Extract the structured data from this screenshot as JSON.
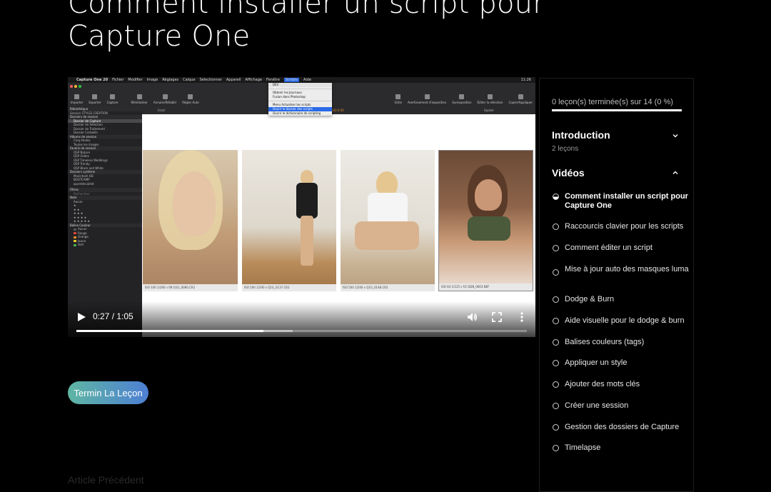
{
  "page": {
    "title": "Comment installer un script pour Capture One",
    "finish_button": "Termin La Leçon",
    "footer_text": "Article Précédent"
  },
  "video": {
    "current_time": "0:27",
    "duration": "1:05",
    "time_display": "0:27 / 1:05",
    "progress_fraction": 0.415,
    "buffered_fraction": 0.48,
    "icons": [
      "play-icon",
      "volume-icon",
      "fullscreen-icon",
      "more-options-icon"
    ],
    "screen": {
      "menubar": [
        "Capture One 20",
        "Fichier",
        "Modifier",
        "Image",
        "Réglages",
        "Calque",
        "Sélectionner",
        "Appareil",
        "Affichage",
        "Fenêtre",
        "Scripts",
        "Aide"
      ],
      "active_menu": "Scripts",
      "clock": "11:26",
      "toolbar_left": [
        "Importer",
        "Exporter",
        "Capture",
        "Réinitialiser",
        "Annuler/Rétablir",
        "Régler Auto"
      ],
      "toolbar_right": [
        "Grille",
        "Avertissement d'exposition",
        "Surexposition",
        "Éditer la sélection",
        "Copier/Appliquer"
      ],
      "scripts_menu": [
        "DEV",
        "Obtenir les Journaux",
        "Fusion dans Photoshop",
        "Menu Actualiser les scripts",
        "Ouvrir le dossier des scripts",
        "Ouvrir le dictionnaire de scripting"
      ],
      "scripts_menu_highlighted": "Ouvrir le dossier des scripts",
      "sidebar": {
        "library_title": "Bibliothèque",
        "session": "Session STYLES CRÉATION",
        "session_folders_title": "Dossiers de session",
        "session_folders": [
          "Dossier de Capture",
          "Dossier de Sélection",
          "Dossier de Traitement",
          "Dossier Corbeille"
        ],
        "session_albums_title": "Albums de session",
        "session_albums": [
          "Cinq étoiles",
          "Toutes les images"
        ],
        "session_favorites_title": "Favoris de session",
        "session_favorites": [
          "QSP Nature",
          "QSP Glides",
          "QSP Timeless Weddings",
          "QSP Trendy",
          "QSP Black and White"
        ],
        "system_folders_title": "Dossiers système",
        "system_folders": [
          "Macintosh HD",
          "BOOTCAMP",
          "quentdecaillet"
        ],
        "filters_title": "Filtres",
        "search_placeholder": "Rechercher",
        "rating_title": "Note",
        "ratings": [
          "Aucun",
          "★",
          "★ ★",
          "★ ★ ★",
          "★ ★ ★ ★",
          "★ ★ ★ ★ ★"
        ],
        "color_tags_title": "Balise Couleur",
        "color_tags": [
          {
            "label": "Aucun",
            "color": "#555555"
          },
          {
            "label": "Rouge",
            "color": "#d9443a"
          },
          {
            "label": "Orange",
            "color": "#e88a2a"
          },
          {
            "label": "Jaune",
            "color": "#e6c72a"
          },
          {
            "label": "Vert",
            "color": "#4caf50"
          }
        ]
      },
      "viewer_head": {
        "zoom": "Fond",
        "fit": "Ajuster",
        "readout": "100  0.00"
      },
      "photos": [
        {
          "caption": "ISO 100   1/200 s   f/8   Q1G_0080.CR2"
        },
        {
          "caption": "ISO 500   1/200 s   Q1G_0137.CR2"
        },
        {
          "caption": "ISO 500   1/200 s   Q1G_0148.CR2"
        },
        {
          "caption": "ISO 64   1/125 s   f/2   QDB_0603.NEF"
        }
      ]
    }
  },
  "course": {
    "progress_text": "0 leçon(s) terminée(s) sur 14 (0 %)",
    "progress_percent": 0,
    "accent_color": "#5fb6a3",
    "sections": [
      {
        "title": "Introduction",
        "subtitle": "2 leçons",
        "expanded": false
      },
      {
        "title": "Vidéos",
        "expanded": true
      }
    ],
    "lessons": [
      {
        "label": "Comment installer un script pour Capture One",
        "status": "current"
      },
      {
        "label": "Raccourcis clavier pour les scripts",
        "status": "todo"
      },
      {
        "label": "Comment éditer un script",
        "status": "todo"
      },
      {
        "label": "Mise à jour auto des masques luma",
        "status": "todo"
      },
      {
        "label": "Dodge & Burn",
        "status": "todo"
      },
      {
        "label": "Aide visuelle pour le dodge & burn",
        "status": "todo"
      },
      {
        "label": "Balises couleurs (tags)",
        "status": "todo"
      },
      {
        "label": "Appliquer un style",
        "status": "todo"
      },
      {
        "label": "Ajouter des mots clés",
        "status": "todo"
      },
      {
        "label": "Créer une session",
        "status": "todo"
      },
      {
        "label": "Gestion des dossiers de Capture",
        "status": "todo"
      },
      {
        "label": "Timelapse",
        "status": "todo"
      }
    ]
  }
}
